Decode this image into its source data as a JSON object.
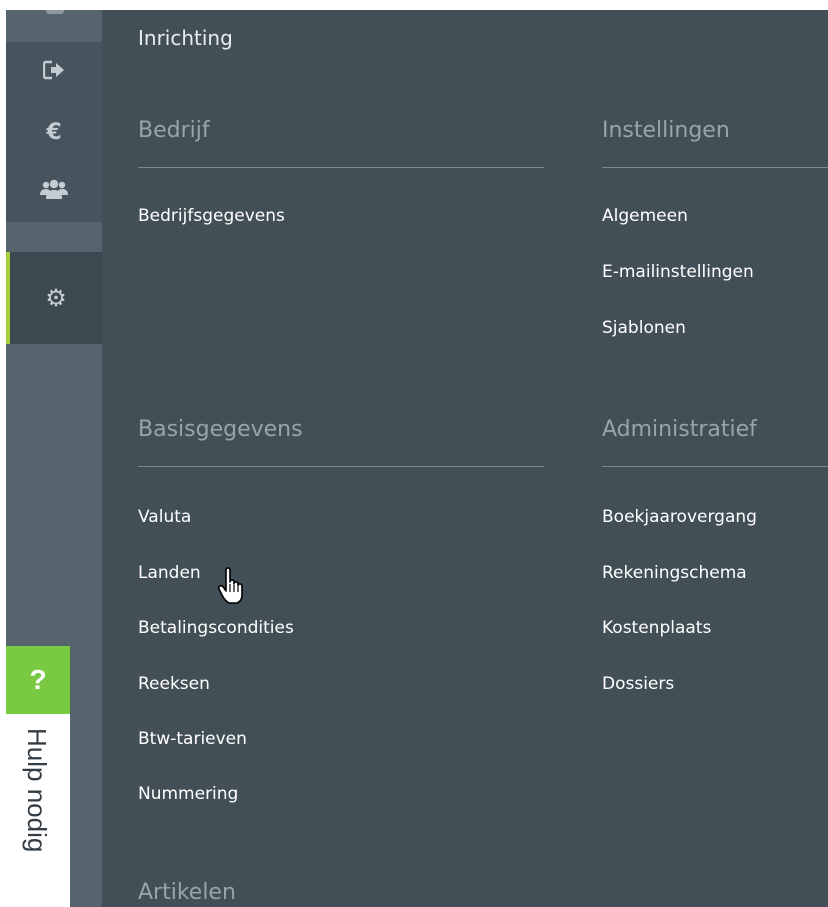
{
  "rail": {
    "items": [
      {
        "icon": "sign-out-icon",
        "glyph": "⇥"
      },
      {
        "icon": "euro-icon",
        "glyph": "€"
      },
      {
        "icon": "users-icon",
        "glyph": ""
      },
      {
        "icon": "gear-icon",
        "glyph": "⚙"
      }
    ],
    "help_symbol": "?",
    "help_label": "Hulp nodig"
  },
  "panel": {
    "title": "Inrichting",
    "sections": {
      "bedrijf": {
        "heading": "Bedrijf",
        "links": [
          "Bedrijfsgegevens"
        ]
      },
      "instellingen": {
        "heading": "Instellingen",
        "links": [
          "Algemeen",
          "E-mailinstellingen",
          "Sjablonen"
        ]
      },
      "basisgegevens": {
        "heading": "Basisgegevens",
        "links": [
          "Valuta",
          "Landen",
          "Betalingscondities",
          "Reeksen",
          "Btw-tarieven",
          "Nummering"
        ]
      },
      "administratief": {
        "heading": "Administratief",
        "links": [
          "Boekjaarovergang",
          "Rekeningschema",
          "Kostenplaats",
          "Dossiers"
        ]
      },
      "artikelen": {
        "heading": "Artikelen"
      }
    }
  },
  "colors": {
    "rail": "#56646d",
    "panel": "#434f57",
    "active_accent": "#a6cf3c",
    "help_green": "#7ac943"
  }
}
